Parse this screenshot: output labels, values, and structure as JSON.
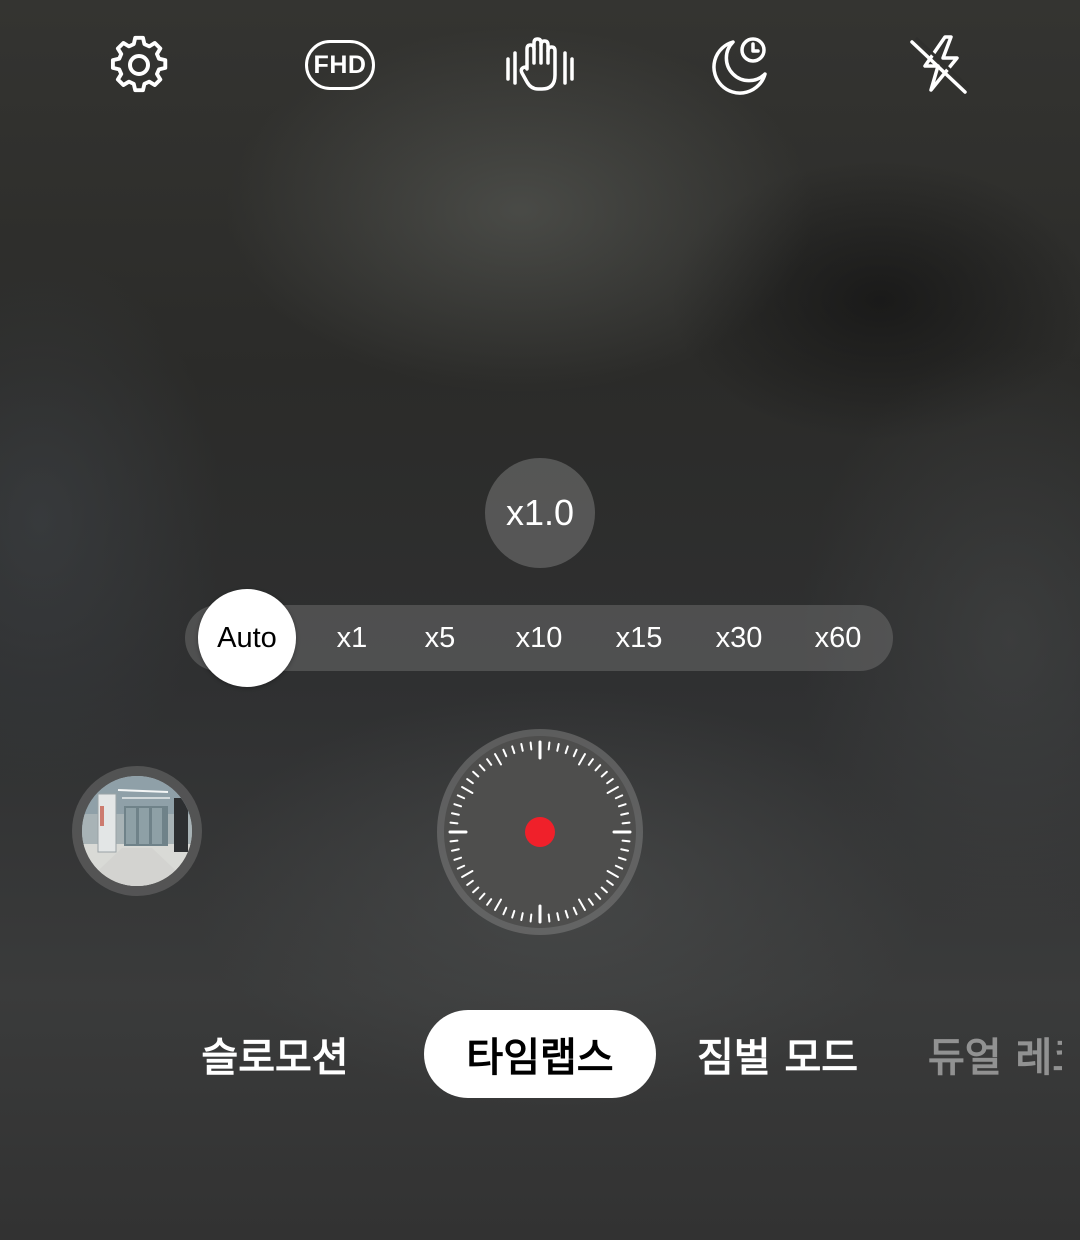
{
  "top_bar": {
    "settings_icon": "gear-icon",
    "resolution_label": "FHD",
    "stabilization_icon": "hyperlapse-hand-icon",
    "night_icon": "night-hyperlapse-icon",
    "flash_icon": "flash-off-icon"
  },
  "zoom": {
    "label": "x1.0"
  },
  "speed_selector": {
    "selected": "Auto",
    "options": [
      "x1",
      "x5",
      "x10",
      "x15",
      "x30",
      "x60"
    ]
  },
  "shutter": {
    "icon": "record-icon",
    "record_color": "#f0202a"
  },
  "gallery": {
    "icon": "gallery-thumbnail"
  },
  "modes": {
    "slow_motion": "슬로모션",
    "time_lapse": "타임랩스",
    "gimbal": "짐벌 모드",
    "dual_recording": "듀얼 레코딩",
    "active": "타임랩스"
  }
}
